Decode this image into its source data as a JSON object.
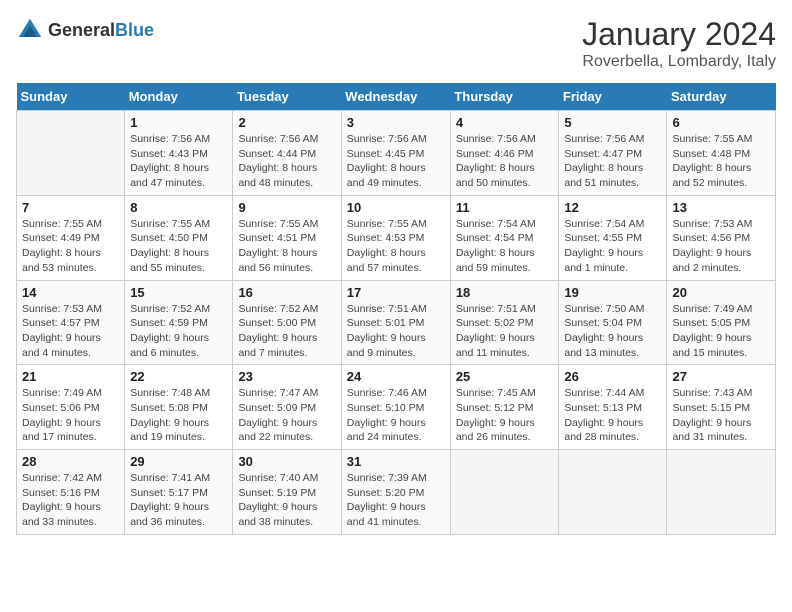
{
  "logo": {
    "general": "General",
    "blue": "Blue"
  },
  "header": {
    "title": "January 2024",
    "subtitle": "Roverbella, Lombardy, Italy"
  },
  "calendar": {
    "weekdays": [
      "Sunday",
      "Monday",
      "Tuesday",
      "Wednesday",
      "Thursday",
      "Friday",
      "Saturday"
    ],
    "weeks": [
      [
        {
          "day": "",
          "detail": ""
        },
        {
          "day": "1",
          "detail": "Sunrise: 7:56 AM\nSunset: 4:43 PM\nDaylight: 8 hours\nand 47 minutes."
        },
        {
          "day": "2",
          "detail": "Sunrise: 7:56 AM\nSunset: 4:44 PM\nDaylight: 8 hours\nand 48 minutes."
        },
        {
          "day": "3",
          "detail": "Sunrise: 7:56 AM\nSunset: 4:45 PM\nDaylight: 8 hours\nand 49 minutes."
        },
        {
          "day": "4",
          "detail": "Sunrise: 7:56 AM\nSunset: 4:46 PM\nDaylight: 8 hours\nand 50 minutes."
        },
        {
          "day": "5",
          "detail": "Sunrise: 7:56 AM\nSunset: 4:47 PM\nDaylight: 8 hours\nand 51 minutes."
        },
        {
          "day": "6",
          "detail": "Sunrise: 7:55 AM\nSunset: 4:48 PM\nDaylight: 8 hours\nand 52 minutes."
        }
      ],
      [
        {
          "day": "7",
          "detail": "Sunrise: 7:55 AM\nSunset: 4:49 PM\nDaylight: 8 hours\nand 53 minutes."
        },
        {
          "day": "8",
          "detail": "Sunrise: 7:55 AM\nSunset: 4:50 PM\nDaylight: 8 hours\nand 55 minutes."
        },
        {
          "day": "9",
          "detail": "Sunrise: 7:55 AM\nSunset: 4:51 PM\nDaylight: 8 hours\nand 56 minutes."
        },
        {
          "day": "10",
          "detail": "Sunrise: 7:55 AM\nSunset: 4:53 PM\nDaylight: 8 hours\nand 57 minutes."
        },
        {
          "day": "11",
          "detail": "Sunrise: 7:54 AM\nSunset: 4:54 PM\nDaylight: 8 hours\nand 59 minutes."
        },
        {
          "day": "12",
          "detail": "Sunrise: 7:54 AM\nSunset: 4:55 PM\nDaylight: 9 hours\nand 1 minute."
        },
        {
          "day": "13",
          "detail": "Sunrise: 7:53 AM\nSunset: 4:56 PM\nDaylight: 9 hours\nand 2 minutes."
        }
      ],
      [
        {
          "day": "14",
          "detail": "Sunrise: 7:53 AM\nSunset: 4:57 PM\nDaylight: 9 hours\nand 4 minutes."
        },
        {
          "day": "15",
          "detail": "Sunrise: 7:52 AM\nSunset: 4:59 PM\nDaylight: 9 hours\nand 6 minutes."
        },
        {
          "day": "16",
          "detail": "Sunrise: 7:52 AM\nSunset: 5:00 PM\nDaylight: 9 hours\nand 7 minutes."
        },
        {
          "day": "17",
          "detail": "Sunrise: 7:51 AM\nSunset: 5:01 PM\nDaylight: 9 hours\nand 9 minutes."
        },
        {
          "day": "18",
          "detail": "Sunrise: 7:51 AM\nSunset: 5:02 PM\nDaylight: 9 hours\nand 11 minutes."
        },
        {
          "day": "19",
          "detail": "Sunrise: 7:50 AM\nSunset: 5:04 PM\nDaylight: 9 hours\nand 13 minutes."
        },
        {
          "day": "20",
          "detail": "Sunrise: 7:49 AM\nSunset: 5:05 PM\nDaylight: 9 hours\nand 15 minutes."
        }
      ],
      [
        {
          "day": "21",
          "detail": "Sunrise: 7:49 AM\nSunset: 5:06 PM\nDaylight: 9 hours\nand 17 minutes."
        },
        {
          "day": "22",
          "detail": "Sunrise: 7:48 AM\nSunset: 5:08 PM\nDaylight: 9 hours\nand 19 minutes."
        },
        {
          "day": "23",
          "detail": "Sunrise: 7:47 AM\nSunset: 5:09 PM\nDaylight: 9 hours\nand 22 minutes."
        },
        {
          "day": "24",
          "detail": "Sunrise: 7:46 AM\nSunset: 5:10 PM\nDaylight: 9 hours\nand 24 minutes."
        },
        {
          "day": "25",
          "detail": "Sunrise: 7:45 AM\nSunset: 5:12 PM\nDaylight: 9 hours\nand 26 minutes."
        },
        {
          "day": "26",
          "detail": "Sunrise: 7:44 AM\nSunset: 5:13 PM\nDaylight: 9 hours\nand 28 minutes."
        },
        {
          "day": "27",
          "detail": "Sunrise: 7:43 AM\nSunset: 5:15 PM\nDaylight: 9 hours\nand 31 minutes."
        }
      ],
      [
        {
          "day": "28",
          "detail": "Sunrise: 7:42 AM\nSunset: 5:16 PM\nDaylight: 9 hours\nand 33 minutes."
        },
        {
          "day": "29",
          "detail": "Sunrise: 7:41 AM\nSunset: 5:17 PM\nDaylight: 9 hours\nand 36 minutes."
        },
        {
          "day": "30",
          "detail": "Sunrise: 7:40 AM\nSunset: 5:19 PM\nDaylight: 9 hours\nand 38 minutes."
        },
        {
          "day": "31",
          "detail": "Sunrise: 7:39 AM\nSunset: 5:20 PM\nDaylight: 9 hours\nand 41 minutes."
        },
        {
          "day": "",
          "detail": ""
        },
        {
          "day": "",
          "detail": ""
        },
        {
          "day": "",
          "detail": ""
        }
      ]
    ]
  }
}
